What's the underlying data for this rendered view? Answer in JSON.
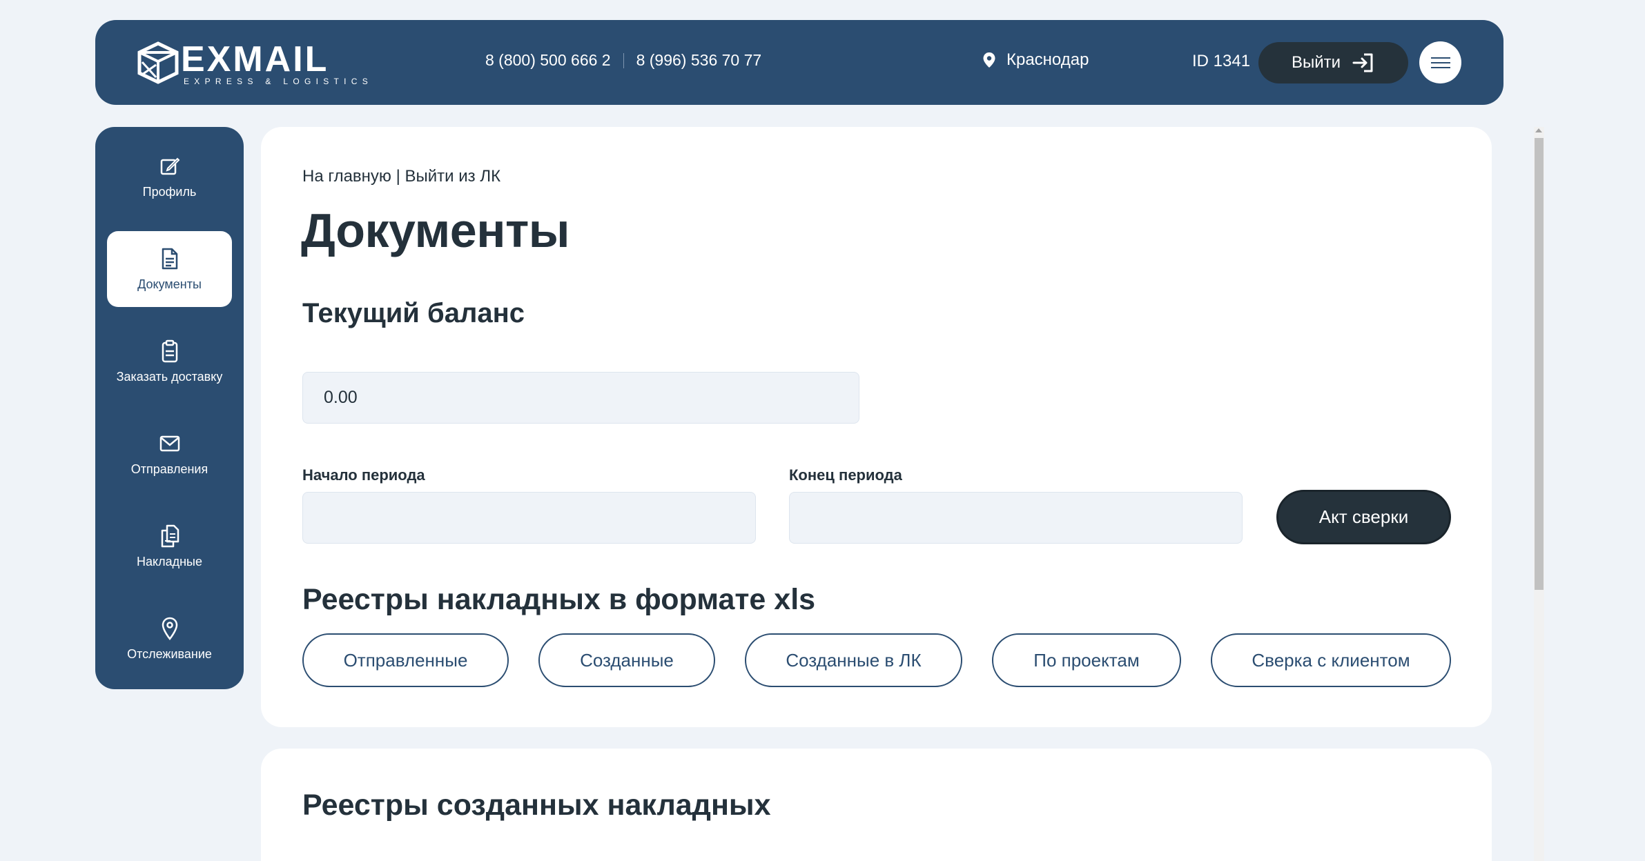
{
  "header": {
    "logo_word": "EXMAIL",
    "logo_sub": "EXPRESS & LOGISTICS",
    "phone_1": "8 (800) 500 666 2",
    "phone_2": "8 (996) 536 70 77",
    "city": "Краснодар",
    "user_id": "ID 1341",
    "logout_label": "Выйти"
  },
  "sidebar": {
    "items": [
      {
        "label": "Профиль",
        "icon": "edit-icon",
        "active": false
      },
      {
        "label": "Документы",
        "icon": "document-icon",
        "active": true
      },
      {
        "label": "Заказать доставку",
        "icon": "clipboard-icon",
        "active": false
      },
      {
        "label": "Отправления",
        "icon": "envelope-icon",
        "active": false
      },
      {
        "label": "Накладные",
        "icon": "files-icon",
        "active": false
      },
      {
        "label": "Отслеживание",
        "icon": "location-pin-icon",
        "active": false
      }
    ]
  },
  "main": {
    "breadcrumb_home": "На главную",
    "breadcrumb_sep": " | ",
    "breadcrumb_logout": "Выйти из ЛК",
    "title": "Документы",
    "balance_title": "Текущий баланс",
    "balance_value": "0.00",
    "period_start_label": "Начало периода",
    "period_end_label": "Конец периода",
    "period_start_value": "",
    "period_end_value": "",
    "act_button": "Акт сверки",
    "xls_title": "Реестры накладных в формате xls",
    "xls_buttons": [
      "Отправленные",
      "Созданные",
      "Созданные в ЛК",
      "По проектам",
      "Сверка с клиентом"
    ]
  },
  "registry": {
    "title": "Реестры созданных накладных"
  },
  "colors": {
    "brand": "#2b4d71",
    "dark_button": "#25323b",
    "page_bg": "#eff3f8",
    "field_bg": "#eff3f8"
  }
}
